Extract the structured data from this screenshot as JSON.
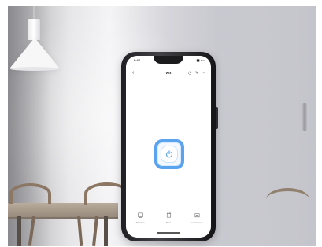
{
  "scene": {
    "background_description": "",
    "accent_color": "#5aa3ef"
  },
  "phone": {
    "status": {
      "time": "9:47",
      "signal": "▮▮ ◔ ▭"
    },
    "header": {
      "back_icon": "back-arrow-icon",
      "title": "Wiz",
      "icons": [
        "timer-icon",
        "edit-icon",
        "more-icon"
      ]
    },
    "main": {
      "power_icon": "power-icon"
    },
    "bottom_nav": {
      "items": [
        {
          "label": "Shadow",
          "icon": "shadow-icon"
        },
        {
          "label": "Time",
          "icon": "time-icon"
        },
        {
          "label": "Countdown",
          "icon": "countdown-icon"
        }
      ]
    }
  }
}
